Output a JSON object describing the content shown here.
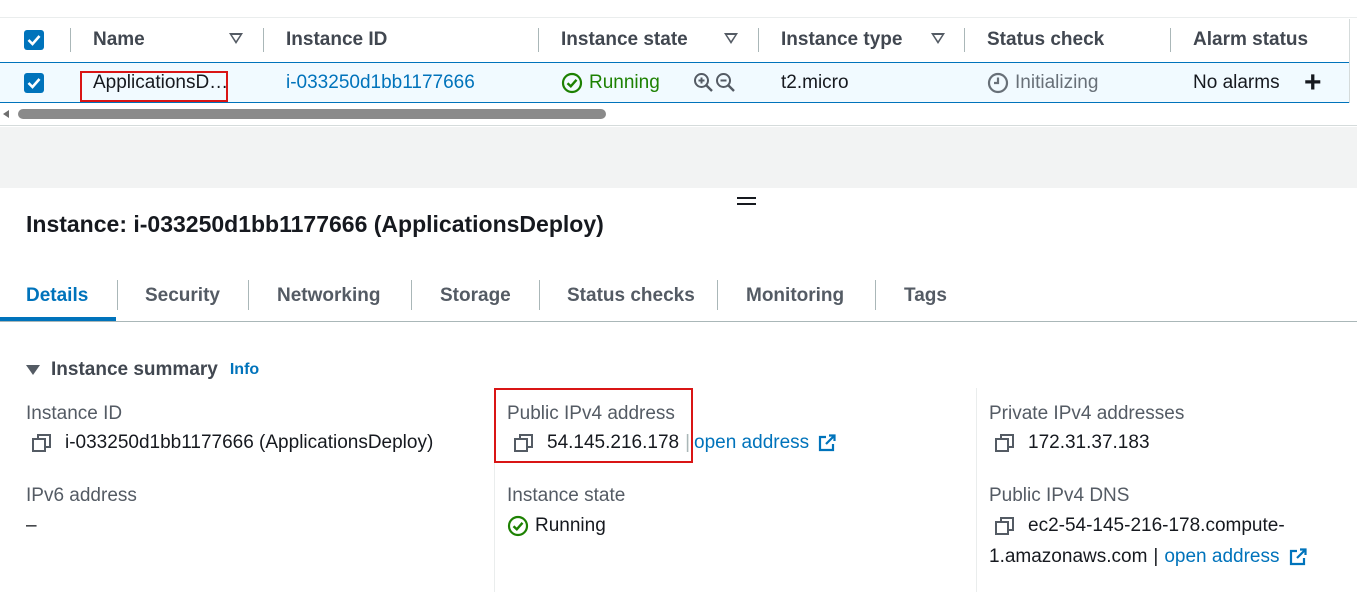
{
  "table": {
    "headers": {
      "name": "Name",
      "instance_id": "Instance ID",
      "instance_state": "Instance state",
      "instance_type": "Instance type",
      "status_check": "Status check",
      "alarm_status": "Alarm status"
    },
    "row": {
      "name": "ApplicationsD…",
      "instance_id": "i-033250d1bb1177666",
      "instance_state": "Running",
      "instance_type": "t2.micro",
      "status_check": "Initializing",
      "alarm_status": "No alarms",
      "add_alarm_symbol": "+"
    }
  },
  "details": {
    "title": "Instance: i-033250d1bb1177666 (ApplicationsDeploy)",
    "tabs": [
      "Details",
      "Security",
      "Networking",
      "Storage",
      "Status checks",
      "Monitoring",
      "Tags"
    ],
    "active_tab": "Details",
    "summary": {
      "heading": "Instance summary",
      "info_link": "Info",
      "instance_id_label": "Instance ID",
      "instance_id_value": "i-033250d1bb1177666 (ApplicationsDeploy)",
      "ipv6_label": "IPv6 address",
      "ipv6_value": "–",
      "public_ipv4_label": "Public IPv4 address",
      "public_ipv4_value": "54.145.216.178",
      "open_address": "open address",
      "separator": "|",
      "instance_state_label": "Instance state",
      "instance_state_value": "Running",
      "private_ipv4_label": "Private IPv4 addresses",
      "private_ipv4_value": "172.31.37.183",
      "public_dns_label": "Public IPv4 DNS",
      "public_dns_line1": "ec2-54-145-216-178.compute-",
      "public_dns_line2": "1.amazonaws.com"
    }
  },
  "colors": {
    "link": "#0073bb",
    "running_green": "#1d8102",
    "highlight_red": "#d91515",
    "selected_row_bg": "#f1faff"
  },
  "icons": [
    "checkbox-checked-icon",
    "sort-icon",
    "running-check-icon",
    "zoom-in-icon",
    "zoom-out-icon",
    "clock-icon",
    "plus-icon",
    "copy-icon",
    "external-link-icon",
    "drag-handle-icon",
    "caret-down-icon"
  ]
}
